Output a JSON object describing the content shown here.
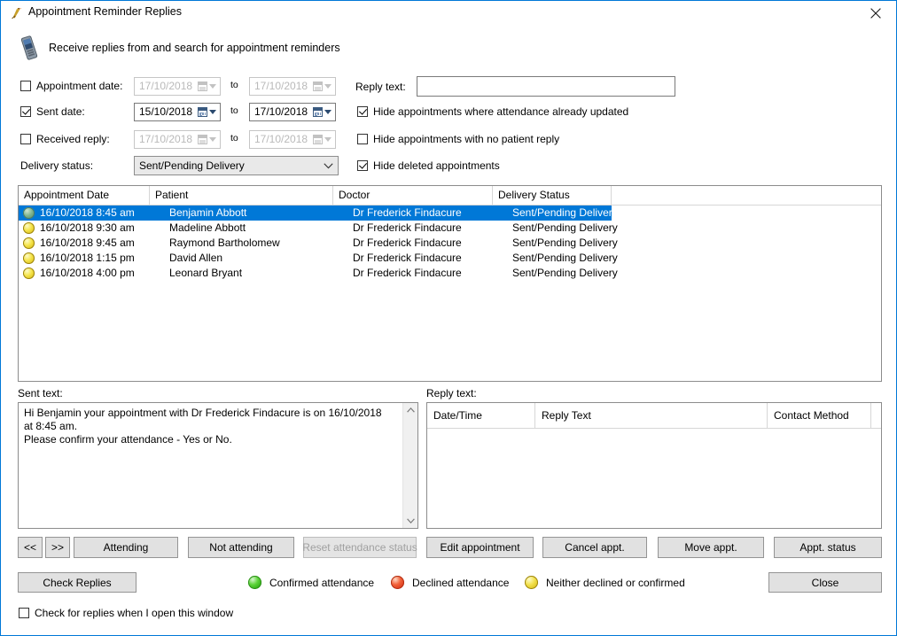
{
  "window": {
    "title": "Appointment Reminder Replies",
    "title_icon": "bird-icon",
    "close_icon": "close-icon"
  },
  "banner": {
    "icon": "mobile-phone-icon",
    "text": "Receive replies from and search for appointment reminders"
  },
  "filters": {
    "appointment_date": {
      "label": "Appointment date:",
      "checked": false,
      "from": "17/10/2018",
      "to_label": "to",
      "to": "17/10/2018"
    },
    "sent_date": {
      "label": "Sent date:",
      "checked": true,
      "from": "15/10/2018",
      "to_label": "to",
      "to": "17/10/2018"
    },
    "received_reply": {
      "label": "Received reply:",
      "checked": false,
      "from": "17/10/2018",
      "to_label": "to",
      "to": "17/10/2018"
    },
    "delivery_status": {
      "label": "Delivery status:",
      "value": "Sent/Pending Delivery",
      "options": [
        "Sent/Pending Delivery"
      ]
    },
    "reply_text": {
      "label": "Reply text:",
      "value": "",
      "placeholder": ""
    },
    "hide_attendance_updated": {
      "label": "Hide appointments where attendance already updated",
      "checked": true
    },
    "hide_no_reply": {
      "label": "Hide appointments with no patient reply",
      "checked": false
    },
    "hide_deleted": {
      "label": "Hide deleted appointments",
      "checked": true
    }
  },
  "appointments_grid": {
    "columns": [
      "Appointment Date",
      "Patient",
      "Doctor",
      "Delivery Status"
    ],
    "rows": [
      {
        "status_icon": "yellow-bulb-icon",
        "date": "16/10/2018 8:45 am",
        "patient": "Benjamin Abbott",
        "doctor": "Dr Frederick Findacure",
        "delivery_status": "Sent/Pending Delivery",
        "selected": true
      },
      {
        "status_icon": "yellow-bulb-icon",
        "date": "16/10/2018 9:30 am",
        "patient": "Madeline Abbott",
        "doctor": "Dr Frederick Findacure",
        "delivery_status": "Sent/Pending Delivery",
        "selected": false
      },
      {
        "status_icon": "yellow-bulb-icon",
        "date": "16/10/2018 9:45 am",
        "patient": "Raymond Bartholomew",
        "doctor": "Dr Frederick Findacure",
        "delivery_status": "Sent/Pending Delivery",
        "selected": false
      },
      {
        "status_icon": "yellow-bulb-icon",
        "date": "16/10/2018 1:15 pm",
        "patient": "David Allen",
        "doctor": "Dr Frederick Findacure",
        "delivery_status": "Sent/Pending Delivery",
        "selected": false
      },
      {
        "status_icon": "yellow-bulb-icon",
        "date": "16/10/2018 4:00 pm",
        "patient": "Leonard Bryant",
        "doctor": "Dr Frederick Findacure",
        "delivery_status": "Sent/Pending Delivery",
        "selected": false
      }
    ]
  },
  "sent_text": {
    "label": "Sent text:",
    "value": "Hi Benjamin your appointment with Dr Frederick Findacure is on 16/10/2018 at 8:45 am.\nPlease confirm your attendance - Yes or No."
  },
  "reply_panel": {
    "label": "Reply text:",
    "columns": [
      "Date/Time",
      "Reply Text",
      "Contact Method"
    ],
    "rows": []
  },
  "actions": {
    "prev": "<<",
    "next": ">>",
    "attending": "Attending",
    "not_attending": "Not attending",
    "reset_attendance": "Reset attendance status",
    "edit_appointment": "Edit appointment",
    "cancel_appt": "Cancel appt.",
    "move_appt": "Move appt.",
    "appt_status": "Appt. status",
    "check_replies": "Check Replies",
    "close": "Close"
  },
  "legend": [
    {
      "color": "#3fbf1f",
      "label": "Confirmed attendance",
      "icon": "green-bulb-icon"
    },
    {
      "color": "#e4492a",
      "label": "Declined attendance",
      "icon": "red-bulb-icon"
    },
    {
      "color": "#ecd832",
      "label": "Neither declined or confirmed",
      "icon": "yellow-bulb-icon"
    }
  ],
  "footer": {
    "check_on_open": {
      "label": "Check for replies when I open this window",
      "checked": false
    }
  },
  "colors": {
    "selection": "#0078d7",
    "window_border": "#0078d7",
    "button_face": "#e1e1e1"
  }
}
